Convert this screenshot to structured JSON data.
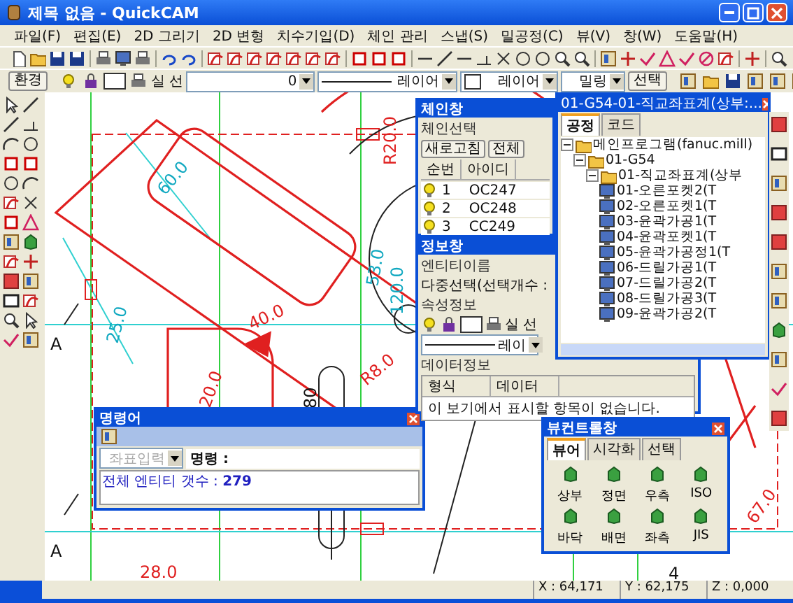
{
  "window": {
    "title": "제목 없음 - QuickCAM"
  },
  "menu": [
    "파일(F)",
    "편집(E)",
    "2D 그리기",
    "2D 변형",
    "치수기입(D)",
    "체인 관리",
    "스냅(S)",
    "밀공정(C)",
    "뷰(V)",
    "창(W)",
    "도움말(H)"
  ],
  "attribute_bar": {
    "env_button": "환경",
    "line_type": "실 선",
    "value": "0",
    "line_style_layer": "레이어",
    "layer": "레이어",
    "mode": "밀링",
    "select_button": "선택"
  },
  "drawing": {
    "labels": [
      "60.0",
      "25.0",
      "40.0",
      "20.0",
      "80",
      "R8.0",
      "R20.0",
      "53.0",
      "120.0",
      "67.0",
      "28.0",
      "A",
      "A",
      "4"
    ]
  },
  "chain_window": {
    "title": "체인창",
    "group": "체인선택",
    "refresh_button": "새로고침",
    "all_button": "전체",
    "columns": [
      "순번",
      "아이디"
    ],
    "rows": [
      {
        "index": "1",
        "id": "OC247"
      },
      {
        "index": "2",
        "id": "OC248"
      },
      {
        "index": "3",
        "id": "CC249"
      }
    ]
  },
  "process_window": {
    "title": "01-G54-01-직교좌표계(상부:...",
    "tabs": [
      {
        "label": "공정",
        "selected": true
      },
      {
        "label": "코드",
        "selected": false
      }
    ],
    "tree": [
      {
        "label": "메인프로그램(fanuc.mill)",
        "expanded": true,
        "children": [
          {
            "label": "01-G54",
            "expanded": true,
            "children": [
              {
                "label": "01-직교좌표계(상부",
                "expanded": true,
                "children": [
                  {
                    "label": "01-오른포켓2(T"
                  },
                  {
                    "label": "02-오른포켓1(T"
                  },
                  {
                    "label": "03-윤곽가공1(T"
                  },
                  {
                    "label": "04-윤곽포켓1(T"
                  },
                  {
                    "label": "05-윤곽가공정1(T"
                  },
                  {
                    "label": "06-드릴가공1(T"
                  },
                  {
                    "label": "07-드릴가공2(T"
                  },
                  {
                    "label": "08-드릴가공3(T"
                  },
                  {
                    "label": "09-윤곽가공2(T"
                  }
                ]
              }
            ]
          }
        ]
      }
    ]
  },
  "info_window": {
    "title": "정보창",
    "entity_name": "엔티티이름",
    "multi_select": "다중선택(선택개수 :",
    "attr_group": "속성정보",
    "line_type": "실 선",
    "layer": "레이",
    "data_group": "데이터정보",
    "columns": [
      "형식",
      "데이터"
    ],
    "empty_message": "이 보기에서 표시할 항목이 없습니다."
  },
  "command_window": {
    "title": "명령어",
    "coord_combo": {
      "value": "좌표입력",
      "disabled": true
    },
    "prompt": "명령 :",
    "output": "전체 엔티티 갯수 : **279**"
  },
  "view_window": {
    "title": "뷰컨트롤창",
    "tabs": [
      {
        "label": "뷰어",
        "selected": true
      },
      {
        "label": "시각화",
        "selected": false
      },
      {
        "label": "선택",
        "selected": false
      }
    ],
    "buttons": [
      "상부",
      "정면",
      "우측",
      "ISO",
      "바닥",
      "배면",
      "좌측",
      "JIS"
    ]
  },
  "status_bar": [
    "X : 64,171",
    "Y : 62,175",
    "Z : 0,000"
  ]
}
